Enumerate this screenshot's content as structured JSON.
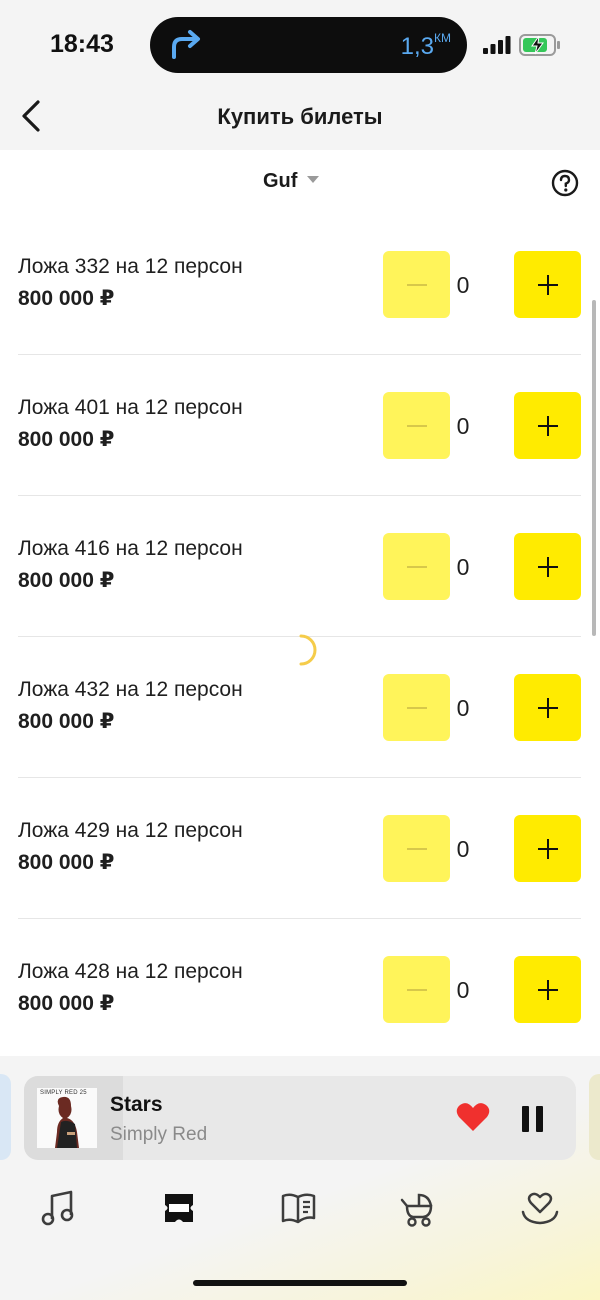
{
  "status_bar": {
    "time": "18:43",
    "navigation_distance": "1,3",
    "navigation_unit": "КМ",
    "icons": [
      "turn-right-arrow-icon",
      "signal-icon",
      "battery-charging-icon"
    ]
  },
  "header": {
    "title": "Купить билеты",
    "back_icon": "chevron-left-icon"
  },
  "filter": {
    "selected_event": "Guf",
    "help_icon": "question-circle-icon"
  },
  "tickets": [
    {
      "name": "Ложа 332 на 12 персон",
      "price": "800 000 ₽",
      "quantity": "0"
    },
    {
      "name": "Ложа 401 на 12 персон",
      "price": "800 000 ₽",
      "quantity": "0"
    },
    {
      "name": "Ложа 416 на 12 персон",
      "price": "800 000 ₽",
      "quantity": "0"
    },
    {
      "name": "Ложа 432 на 12 персон",
      "price": "800 000 ₽",
      "quantity": "0"
    },
    {
      "name": "Ложа 429 на 12 персон",
      "price": "800 000 ₽",
      "quantity": "0"
    },
    {
      "name": "Ложа 428 на 12 персон",
      "price": "800 000 ₽",
      "quantity": "0"
    }
  ],
  "player": {
    "title": "Stars",
    "artist": "Simply Red",
    "cover_text": "SIMPLY RED 25",
    "progress": 0.18,
    "liked": true
  },
  "tabs": [
    {
      "id": "music",
      "icon": "music-note-icon"
    },
    {
      "id": "afisha",
      "icon": "ticket-icon",
      "active": true
    },
    {
      "id": "books",
      "icon": "book-icon"
    },
    {
      "id": "kids",
      "icon": "stroller-icon"
    },
    {
      "id": "favorites",
      "icon": "heart-hand-icon"
    }
  ],
  "colors": {
    "accent_yellow": "#ffeb00",
    "disabled_yellow": "#fff45a",
    "heart_red": "#f0302e",
    "nav_blue": "#5aa9f0"
  }
}
